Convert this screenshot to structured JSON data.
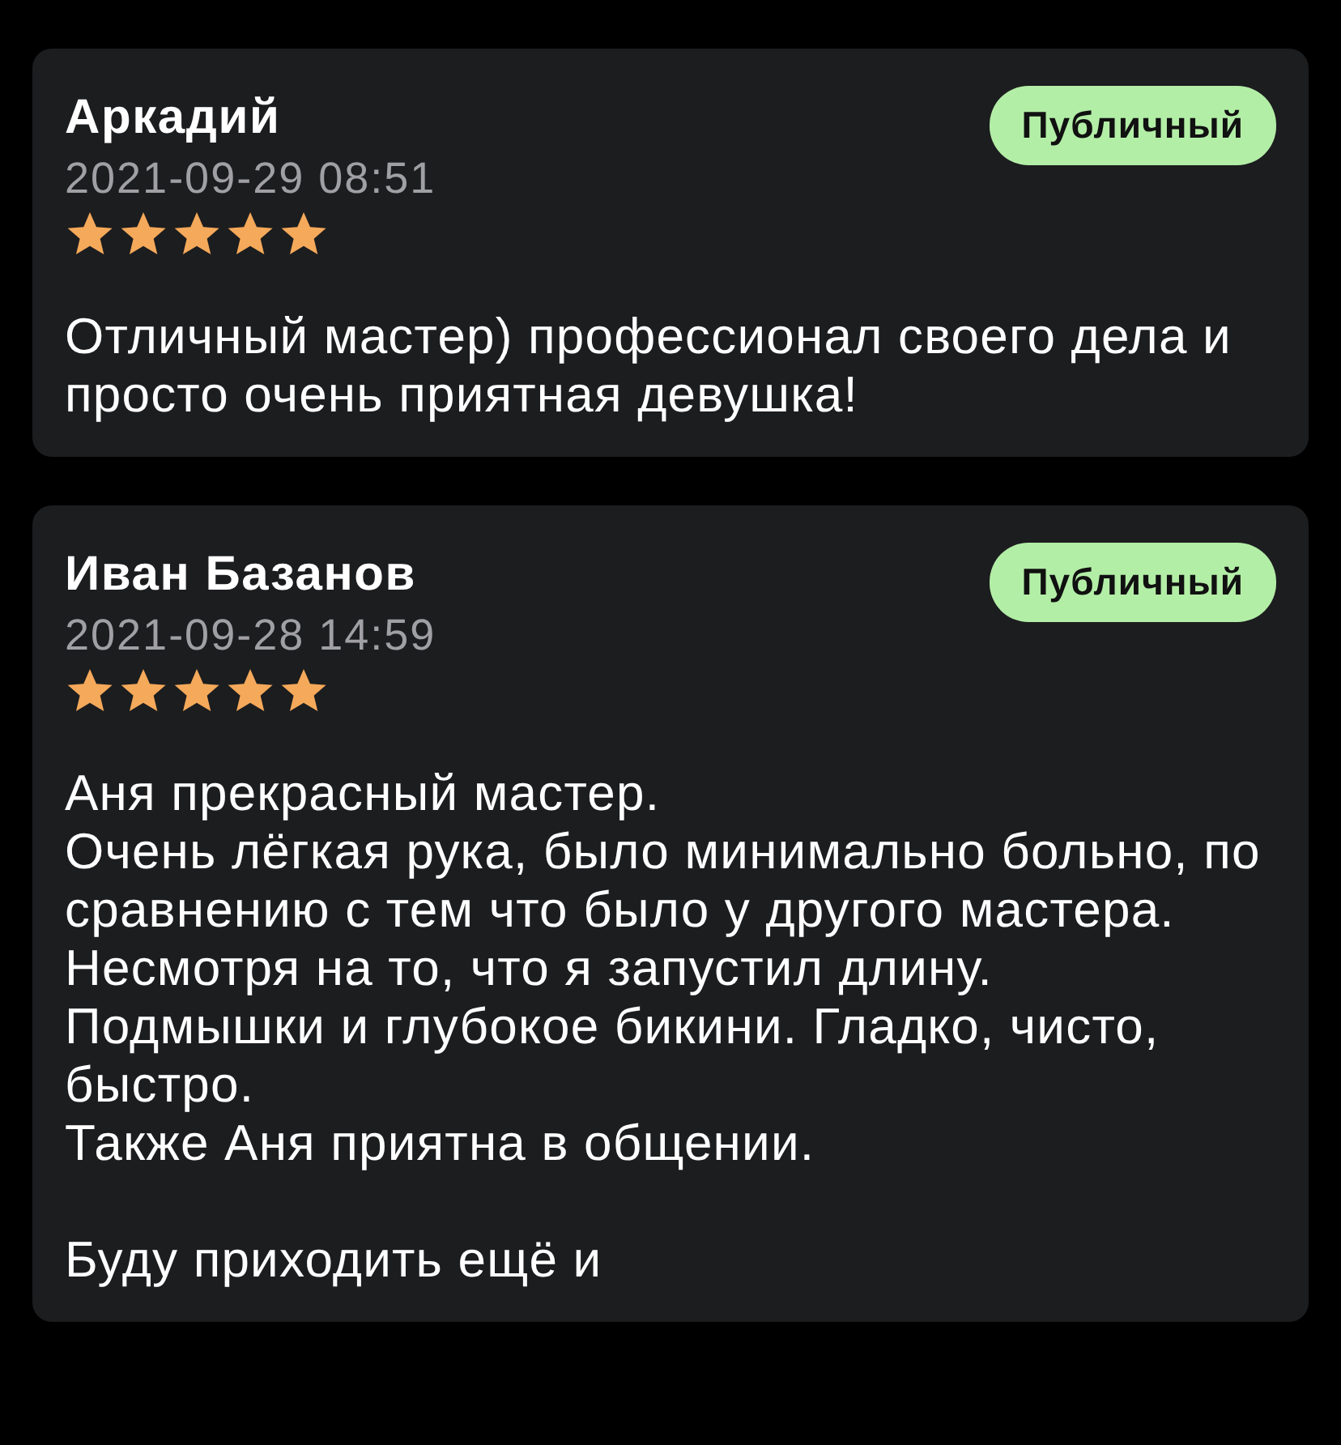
{
  "reviews": [
    {
      "name": "Аркадий",
      "badge": "Публичный",
      "date": "2021-09-29 08:51",
      "stars": 5,
      "text": "Отличный мастер) профессионал своего дела и просто очень приятная девушка!"
    },
    {
      "name": "Иван Базанов",
      "badge": "Публичный",
      "date": "2021-09-28 14:59",
      "stars": 5,
      "text": "Аня прекрасный мастер.\nОчень лёгкая рука, было минимально больно, по сравнению с тем что было у другого мастера. Несмотря на то, что я запустил длину.\nПодмышки и глубокое бикини. Гладко, чисто, быстро.\nТакже Аня приятна в общении.\n\nБуду приходить ещё и"
    }
  ]
}
